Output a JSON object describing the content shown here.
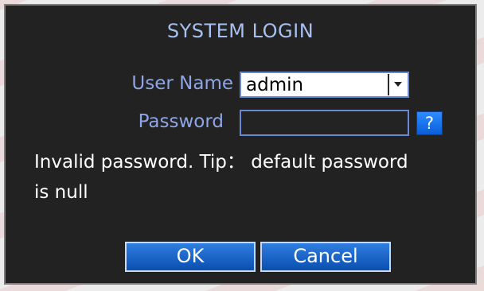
{
  "dialog": {
    "title": "SYSTEM LOGIN",
    "user_name_label": "User Name",
    "user_name_value": "admin",
    "password_label": "Password",
    "password_value": "",
    "help_label": "?",
    "message": "Invalid password. Tip： default password is null",
    "ok_label": "OK",
    "cancel_label": "Cancel"
  },
  "colors": {
    "dialog_bg": "#222222",
    "label": "#8fa6e6",
    "title": "#a7c0f0",
    "button_blue": "#1e6fd8"
  },
  "icons": {
    "dropdown": "chevron-down-icon"
  }
}
